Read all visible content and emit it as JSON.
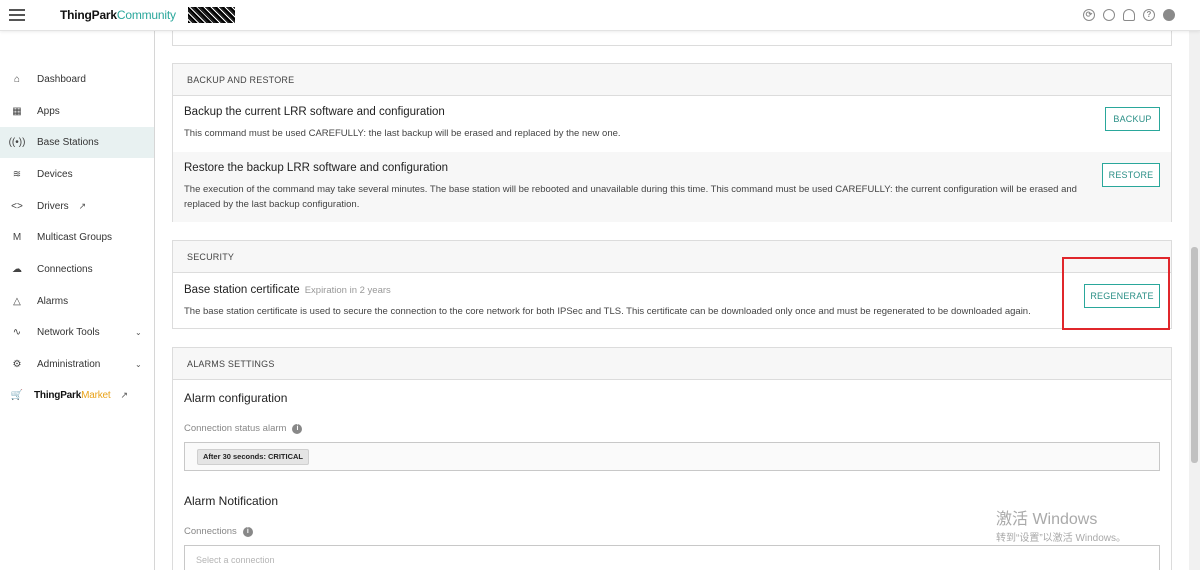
{
  "header": {
    "logo_main": "ThingPark",
    "logo_accent": "Community",
    "icons": [
      "refresh-icon",
      "search-icon",
      "bell-icon",
      "help-icon",
      "user-icon"
    ]
  },
  "sidebar": {
    "items": [
      {
        "label": "Dashboard",
        "icon": "home-icon"
      },
      {
        "label": "Apps",
        "icon": "apps-icon"
      },
      {
        "label": "Base Stations",
        "icon": "antenna-icon",
        "active": true
      },
      {
        "label": "Devices",
        "icon": "device-icon"
      },
      {
        "label": "Drivers",
        "icon": "code-icon"
      },
      {
        "label": "Multicast Groups",
        "icon": "multicast-icon"
      },
      {
        "label": "Connections",
        "icon": "cloud-icon"
      },
      {
        "label": "Alarms",
        "icon": "alarm-icon"
      },
      {
        "label": "Network Tools",
        "icon": "waveform-icon"
      },
      {
        "label": "Administration",
        "icon": "gear-icon"
      }
    ],
    "market_main": "ThingPark",
    "market_accent": "Market"
  },
  "backup": {
    "heading": "BACKUP AND RESTORE",
    "backup_title": "Backup the current LRR software and configuration",
    "backup_desc": "This command must be used CAREFULLY: the last backup will be erased and replaced by the new one.",
    "backup_btn": "BACKUP",
    "restore_title": "Restore the backup LRR software and configuration",
    "restore_desc": "The execution of the command may take several minutes. The base station will be rebooted and unavailable during this time. This command must be used CAREFULLY: the current configuration will be erased and replaced by the last backup configuration.",
    "restore_btn": "RESTORE"
  },
  "security": {
    "heading": "SECURITY",
    "cert_title": "Base station certificate",
    "cert_expiry": "Expiration in 2 years",
    "cert_desc": "The base station certificate is used to secure the connection to the core network for both IPSec and TLS. This certificate can be downloaded only once and must be regenerated to be downloaded again.",
    "regen_btn": "REGENERATE",
    "highlight_color": "#e0262b"
  },
  "alarms": {
    "heading": "ALARMS SETTINGS",
    "config_title": "Alarm configuration",
    "status_label": "Connection status alarm",
    "status_chip": "After 30 seconds: CRITICAL",
    "notif_title": "Alarm Notification",
    "connections_label": "Connections",
    "connections_placeholder": "Select a connection"
  },
  "watermark": {
    "line1": "激活 Windows",
    "line2": "转到“设置”以激活 Windows。"
  },
  "colors": {
    "accent": "#2aa79b",
    "market_accent": "#e9a31a",
    "active_nav_bg": "#e8f1f1"
  }
}
